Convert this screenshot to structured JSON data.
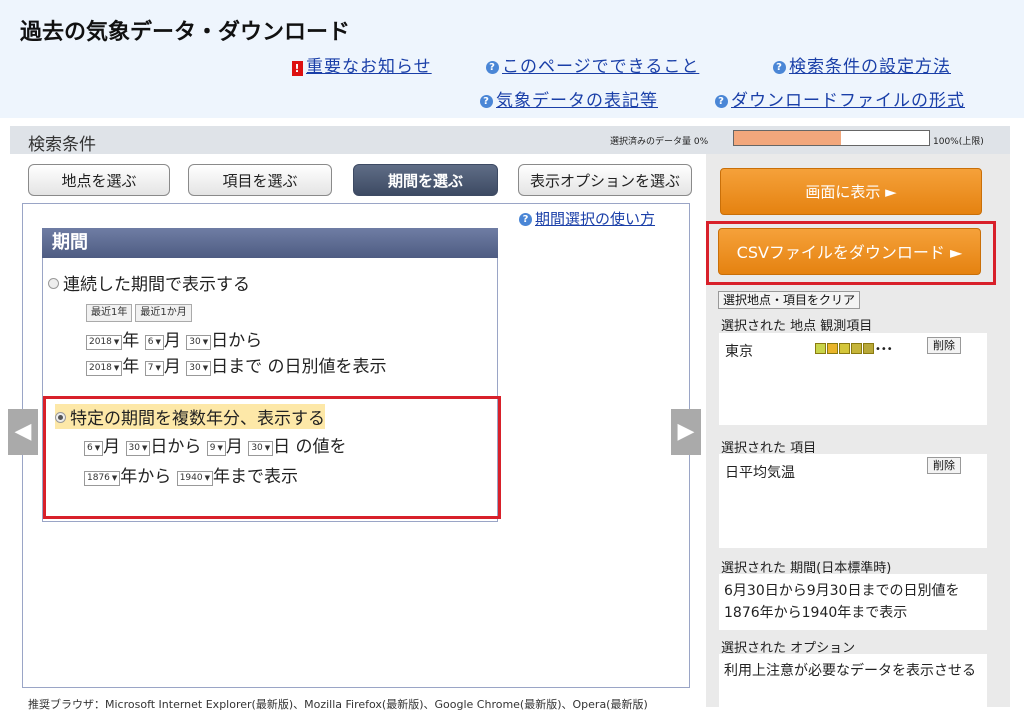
{
  "header": {
    "title": "過去の気象データ・ダウンロード",
    "links": {
      "notice": "重要なお知らせ",
      "about": "このページでできること",
      "howto_search": "検索条件の設定方法",
      "notation": "気象データの表記等",
      "file_format": "ダウンロードファイルの形式"
    }
  },
  "search": {
    "label": "検索条件",
    "progress_label": "選択済みのデータ量 0%",
    "progress_max": "100%(上限)",
    "progress_percent": 55
  },
  "tabs": [
    {
      "label": "地点を選ぶ"
    },
    {
      "label": "項目を選ぶ"
    },
    {
      "label": "期間を選ぶ",
      "active": true
    },
    {
      "label": "表示オプションを選ぶ"
    }
  ],
  "period": {
    "help_link": "期間選択の使い方",
    "heading": "期間",
    "continuous": {
      "label": "連続した期間で表示する",
      "quick_buttons": [
        "最近1年",
        "最近1か月"
      ],
      "start": {
        "year": "2018",
        "month": "6",
        "day": "30"
      },
      "end": {
        "year": "2018",
        "month": "7",
        "day": "30"
      },
      "year_unit": "年",
      "month_unit": "月",
      "from_text": "日から",
      "until_text": "日まで の日別値を表示"
    },
    "multi_year": {
      "label": "特定の期間を複数年分、表示する",
      "start_month": "6",
      "start_day": "30",
      "end_month": "9",
      "end_day": "30",
      "month_unit": "月",
      "from_text": "日から",
      "day_values_text": "日 の値を",
      "start_year": "1876",
      "end_year": "1940",
      "year_from_text": "年から",
      "year_until_text": "年まで表示"
    }
  },
  "actions": {
    "display": "画面に表示 ►",
    "csv": "CSVファイルをダウンロード ►",
    "clear": "選択地点・項目をクリア"
  },
  "selected": {
    "station_label": "選択された 地点  観測項目",
    "station": "東京",
    "station_icons": [
      "rain-icon",
      "sun-icon",
      "cloud-icon",
      "wind-icon",
      "snow-icon",
      "more-icon"
    ],
    "delete": "削除",
    "items_label": "選択された 項目",
    "item": "日平均気温",
    "period_label": "選択された 期間(日本標準時)",
    "period_text": "6月30日から9月30日までの日別値を1876年から1940年まで表示",
    "options_label": "選択された オプション",
    "options_text": "利用上注意が必要なデータを表示させる"
  },
  "footer": {
    "browsers": "推奨ブラウザ：Microsoft Internet Explorer(最新版)、Mozilla Firefox(最新版)、Google Chrome(最新版)、Opera(最新版)"
  },
  "colors": {
    "accent_orange": "#e58210",
    "highlight_red": "#d8202a",
    "tab_active": "#4a5770"
  }
}
